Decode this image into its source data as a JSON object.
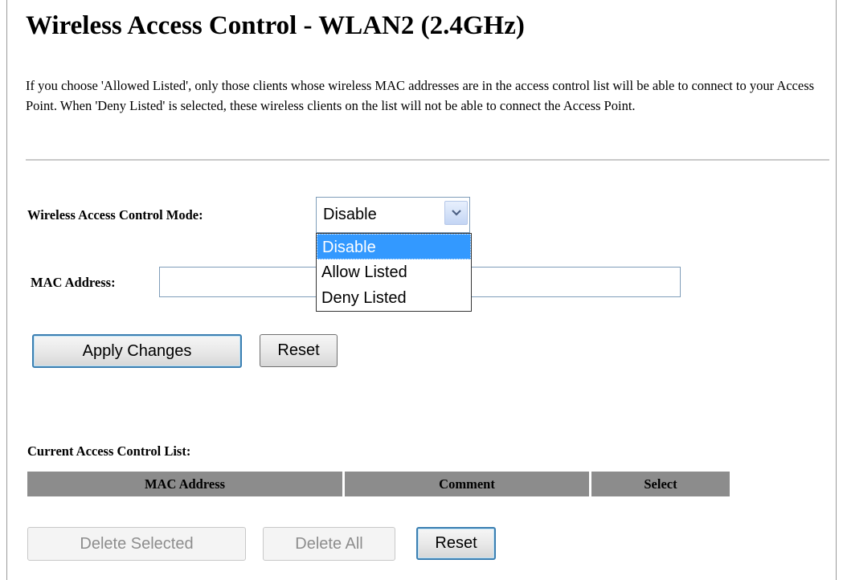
{
  "page": {
    "title": "Wireless Access Control - WLAN2 (2.4GHz)",
    "description": "If you choose 'Allowed Listed', only those clients whose wireless MAC addresses are in the access control list will be able to connect to your Access Point. When 'Deny Listed' is selected, these wireless clients on the list will not be able to connect the Access Point."
  },
  "form": {
    "mode_label": "Wireless Access Control Mode:",
    "mode_value": "Disable",
    "mode_options": [
      "Disable",
      "Allow Listed",
      "Deny Listed"
    ],
    "mac_label": "MAC Address:",
    "mac_value": "",
    "apply_label": "Apply Changes",
    "reset_label": "Reset"
  },
  "list": {
    "heading": "Current Access Control List:",
    "columns": [
      "MAC Address",
      "Comment",
      "Select"
    ],
    "rows": [],
    "delete_selected_label": "Delete Selected",
    "delete_all_label": "Delete All",
    "reset_label": "Reset"
  },
  "icons": {
    "dropdown_arrow": "chevron-down-icon"
  },
  "colors": {
    "dropdown_highlight": "#3399ff",
    "table_header": "#8c8c8c",
    "focus_border": "#3c7fb1"
  }
}
